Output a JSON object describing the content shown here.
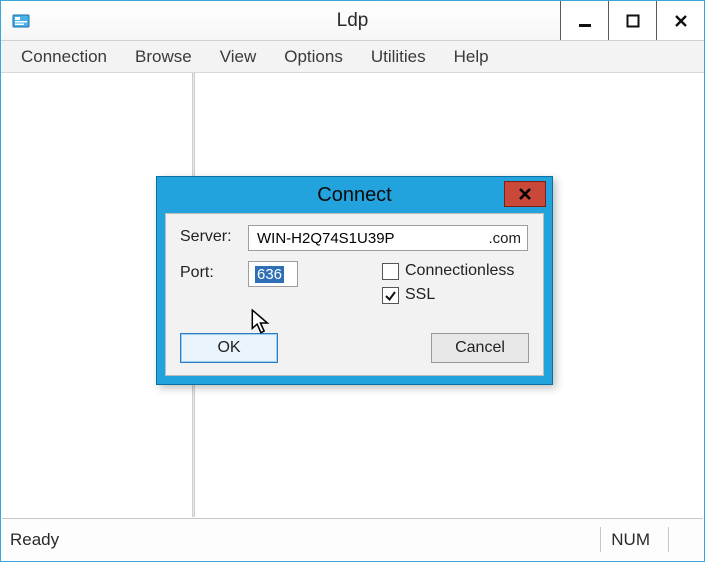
{
  "window": {
    "title": "Ldp"
  },
  "menubar": {
    "items": [
      "Connection",
      "Browse",
      "View",
      "Options",
      "Utilities",
      "Help"
    ]
  },
  "statusbar": {
    "left": "Ready",
    "num": "NUM"
  },
  "dialog": {
    "title": "Connect",
    "server_label": "Server:",
    "server_value": "WIN-H2Q74S1U39P",
    "server_suffix": ".com",
    "port_label": "Port:",
    "port_value": "636",
    "connectionless_label": "Connectionless",
    "connectionless_checked": false,
    "ssl_label": "SSL",
    "ssl_checked": true,
    "ok_label": "OK",
    "cancel_label": "Cancel"
  }
}
